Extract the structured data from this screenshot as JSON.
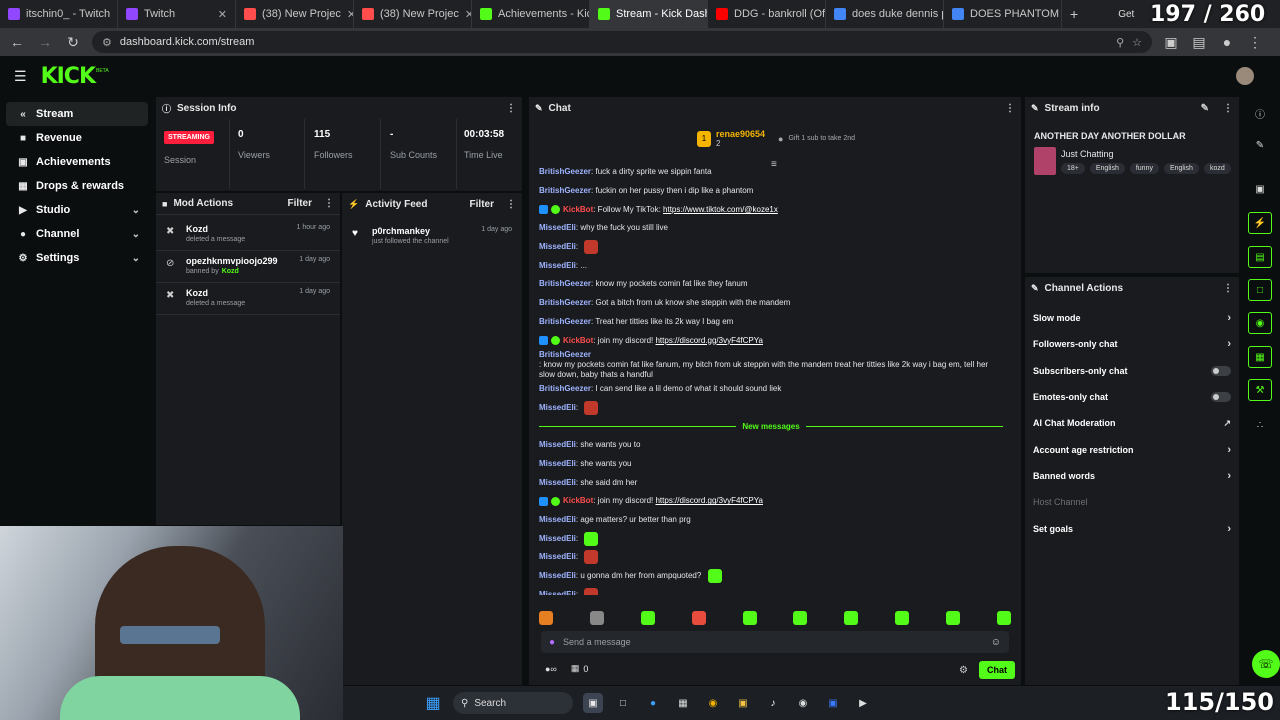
{
  "browser": {
    "tabs": [
      {
        "label": "itschin0_ - Twitch",
        "color": "#9146ff"
      },
      {
        "label": "Twitch",
        "color": "#9146ff"
      },
      {
        "label": "(38) New Projec",
        "color": "#ff4d4d"
      },
      {
        "label": "(38) New Projec",
        "color": "#ff4d4d"
      },
      {
        "label": "Achievements - Kick",
        "color": "#53fc18"
      },
      {
        "label": "Stream - Kick Dashb",
        "color": "#53fc18"
      },
      {
        "label": "DDG - bankroll (Off",
        "color": "#ff0000"
      },
      {
        "label": "does duke dennis p",
        "color": "#4285f4"
      },
      {
        "label": "DOES PHANTOM R",
        "color": "#4285f4"
      }
    ],
    "new_tab": "+",
    "get_label": "Get",
    "url": "dashboard.kick.com/stream"
  },
  "overlay": {
    "top_counter": "197 / 260",
    "bottom_counter": "115/150"
  },
  "kick": {
    "logo": "KICK",
    "beta": "BETA"
  },
  "sidebar": {
    "items": [
      {
        "label": "Stream",
        "icon": "stream-icon"
      },
      {
        "label": "Revenue",
        "icon": "revenue-icon"
      },
      {
        "label": "Achievements",
        "icon": "achievements-icon"
      },
      {
        "label": "Drops & rewards",
        "icon": "drops-icon"
      },
      {
        "label": "Studio",
        "icon": "studio-icon"
      },
      {
        "label": "Channel",
        "icon": "channel-icon"
      },
      {
        "label": "Settings",
        "icon": "settings-icon"
      }
    ]
  },
  "session": {
    "title": "Session Info",
    "status": "STREAMING",
    "status_label": "Session",
    "stats": [
      {
        "value": "0",
        "label": "Viewers"
      },
      {
        "value": "115",
        "label": "Followers"
      },
      {
        "value": "-",
        "label": "Sub Counts"
      },
      {
        "value": "00:03:58",
        "label": "Time Live"
      }
    ]
  },
  "mod_actions": {
    "title": "Mod Actions",
    "filter": "Filter",
    "items": [
      {
        "name": "Kozd",
        "sub": "deleted a message",
        "time": "1 hour ago",
        "by": ""
      },
      {
        "name": "opezhknmvpioojo299",
        "sub": "banned by",
        "time": "1 day ago",
        "by": "Kozd"
      },
      {
        "name": "Kozd",
        "sub": "deleted a message",
        "time": "1 day ago",
        "by": ""
      }
    ]
  },
  "activity": {
    "title": "Activity Feed",
    "filter": "Filter",
    "items": [
      {
        "name": "p0rchmankey",
        "sub": "just followed the channel",
        "time": "1 day ago"
      }
    ]
  },
  "chat": {
    "title": "Chat",
    "pinned_user": "renae90654",
    "pinned_count": "2",
    "gift_label": "Gift 1 sub to take 2nd",
    "new_messages": "New messages",
    "messages": [
      {
        "user": "BritishGeezer",
        "text": ": fuck a dirty sprite we sippin fanta",
        "cls": "u-brit"
      },
      {
        "user": "BritishGeezer",
        "text": ": fuckin on her pussy then i dip like a phantom",
        "cls": "u-brit"
      },
      {
        "user": "KickBot",
        "text": ": Follow My TikTok: ",
        "link": "https://www.tiktok.com/@koze1x",
        "cls": "u-bot",
        "bot": true
      },
      {
        "user": "MissedEli",
        "text": ": why the fuck you still live",
        "cls": "u-miss"
      },
      {
        "user": "MissedEli",
        "text": ": ",
        "emote": "#c0392b",
        "cls": "u-miss"
      },
      {
        "user": "MissedEli",
        "text": ": ...",
        "cls": "u-miss"
      },
      {
        "user": "BritishGeezer",
        "text": ": know my pockets comin fat like they fanum",
        "cls": "u-brit"
      },
      {
        "user": "BritishGeezer",
        "text": ": Got a bitch from uk know she steppin with the mandem",
        "cls": "u-brit"
      },
      {
        "user": "BritishGeezer",
        "text": ": Treat her titties like its 2k way I bag em",
        "cls": "u-brit"
      },
      {
        "user": "KickBot",
        "text": ": join my discord! ",
        "link": "https://discord.gg/3vyF4fCPYa",
        "cls": "u-bot",
        "bot": true
      },
      {
        "user": "BritishGeezer",
        "text": ": know my pockets comin fat like fanum, my bitch from uk steppin with the mandem treat her titties like 2k way i bag em, tell her slow down, baby thats a handful",
        "cls": "u-brit",
        "tall": true
      },
      {
        "user": "BritishGeezer",
        "text": ": I can send like a lil demo of what it should sound liek",
        "cls": "u-brit"
      },
      {
        "user": "MissedEli",
        "text": ": ",
        "emote": "#c0392b",
        "cls": "u-miss"
      },
      {
        "divider": true
      },
      {
        "user": "MissedEli",
        "text": ": she wants you to",
        "cls": "u-miss"
      },
      {
        "user": "MissedEli",
        "text": ": she wants you",
        "cls": "u-miss"
      },
      {
        "user": "MissedEli",
        "text": ": she said dm her",
        "cls": "u-miss"
      },
      {
        "user": "KickBot",
        "text": ": join my discord! ",
        "link": "https://discord.gg/3vyF4fCPYa",
        "cls": "u-bot",
        "bot": true
      },
      {
        "user": "MissedEli",
        "text": ": age matters? ur better than prg",
        "cls": "u-miss"
      },
      {
        "user": "MissedEli",
        "text": ": ",
        "emote": "#53fc18",
        "cls": "u-miss"
      },
      {
        "user": "MissedEli",
        "text": ": ",
        "emote": "#c0392b",
        "cls": "u-miss"
      },
      {
        "user": "MissedEli",
        "text": ": u gonna dm her from ampquoted? ",
        "emote": "#53fc18",
        "cls": "u-miss"
      },
      {
        "user": "MissedEli",
        "text": ": ",
        "emote": "#c0392b",
        "cls": "u-miss"
      }
    ],
    "emote_bar": [
      "#e67e22",
      "#888888",
      "#53fc18",
      "#e74c3c",
      "#53fc18",
      "#53fc18",
      "#53fc18",
      "#53fc18",
      "#53fc18",
      "#53fc18"
    ],
    "input_placeholder": "Send a message",
    "count_a": "",
    "count_b": "0",
    "send_label": "Chat"
  },
  "stream_info": {
    "title": "Stream info",
    "stream_title": "ANOTHER DAY ANOTHER DOLLAR",
    "category": "Just Chatting",
    "tags": [
      "18+",
      "English",
      "funny",
      "English",
      "kozd"
    ]
  },
  "channel_actions": {
    "title": "Channel Actions",
    "items": [
      {
        "label": "Slow mode",
        "kind": "chevron"
      },
      {
        "label": "Followers-only chat",
        "kind": "chevron"
      },
      {
        "label": "Subscribers-only chat",
        "kind": "toggle"
      },
      {
        "label": "Emotes-only chat",
        "kind": "toggle"
      },
      {
        "label": "AI Chat Moderation",
        "kind": "external"
      },
      {
        "label": "Account age restriction",
        "kind": "chevron"
      },
      {
        "label": "Banned words",
        "kind": "chevron"
      },
      {
        "label": "Host Channel",
        "kind": "disabled"
      },
      {
        "label": "Set goals",
        "kind": "chevron"
      }
    ]
  },
  "taskbar": {
    "search": "Search"
  }
}
